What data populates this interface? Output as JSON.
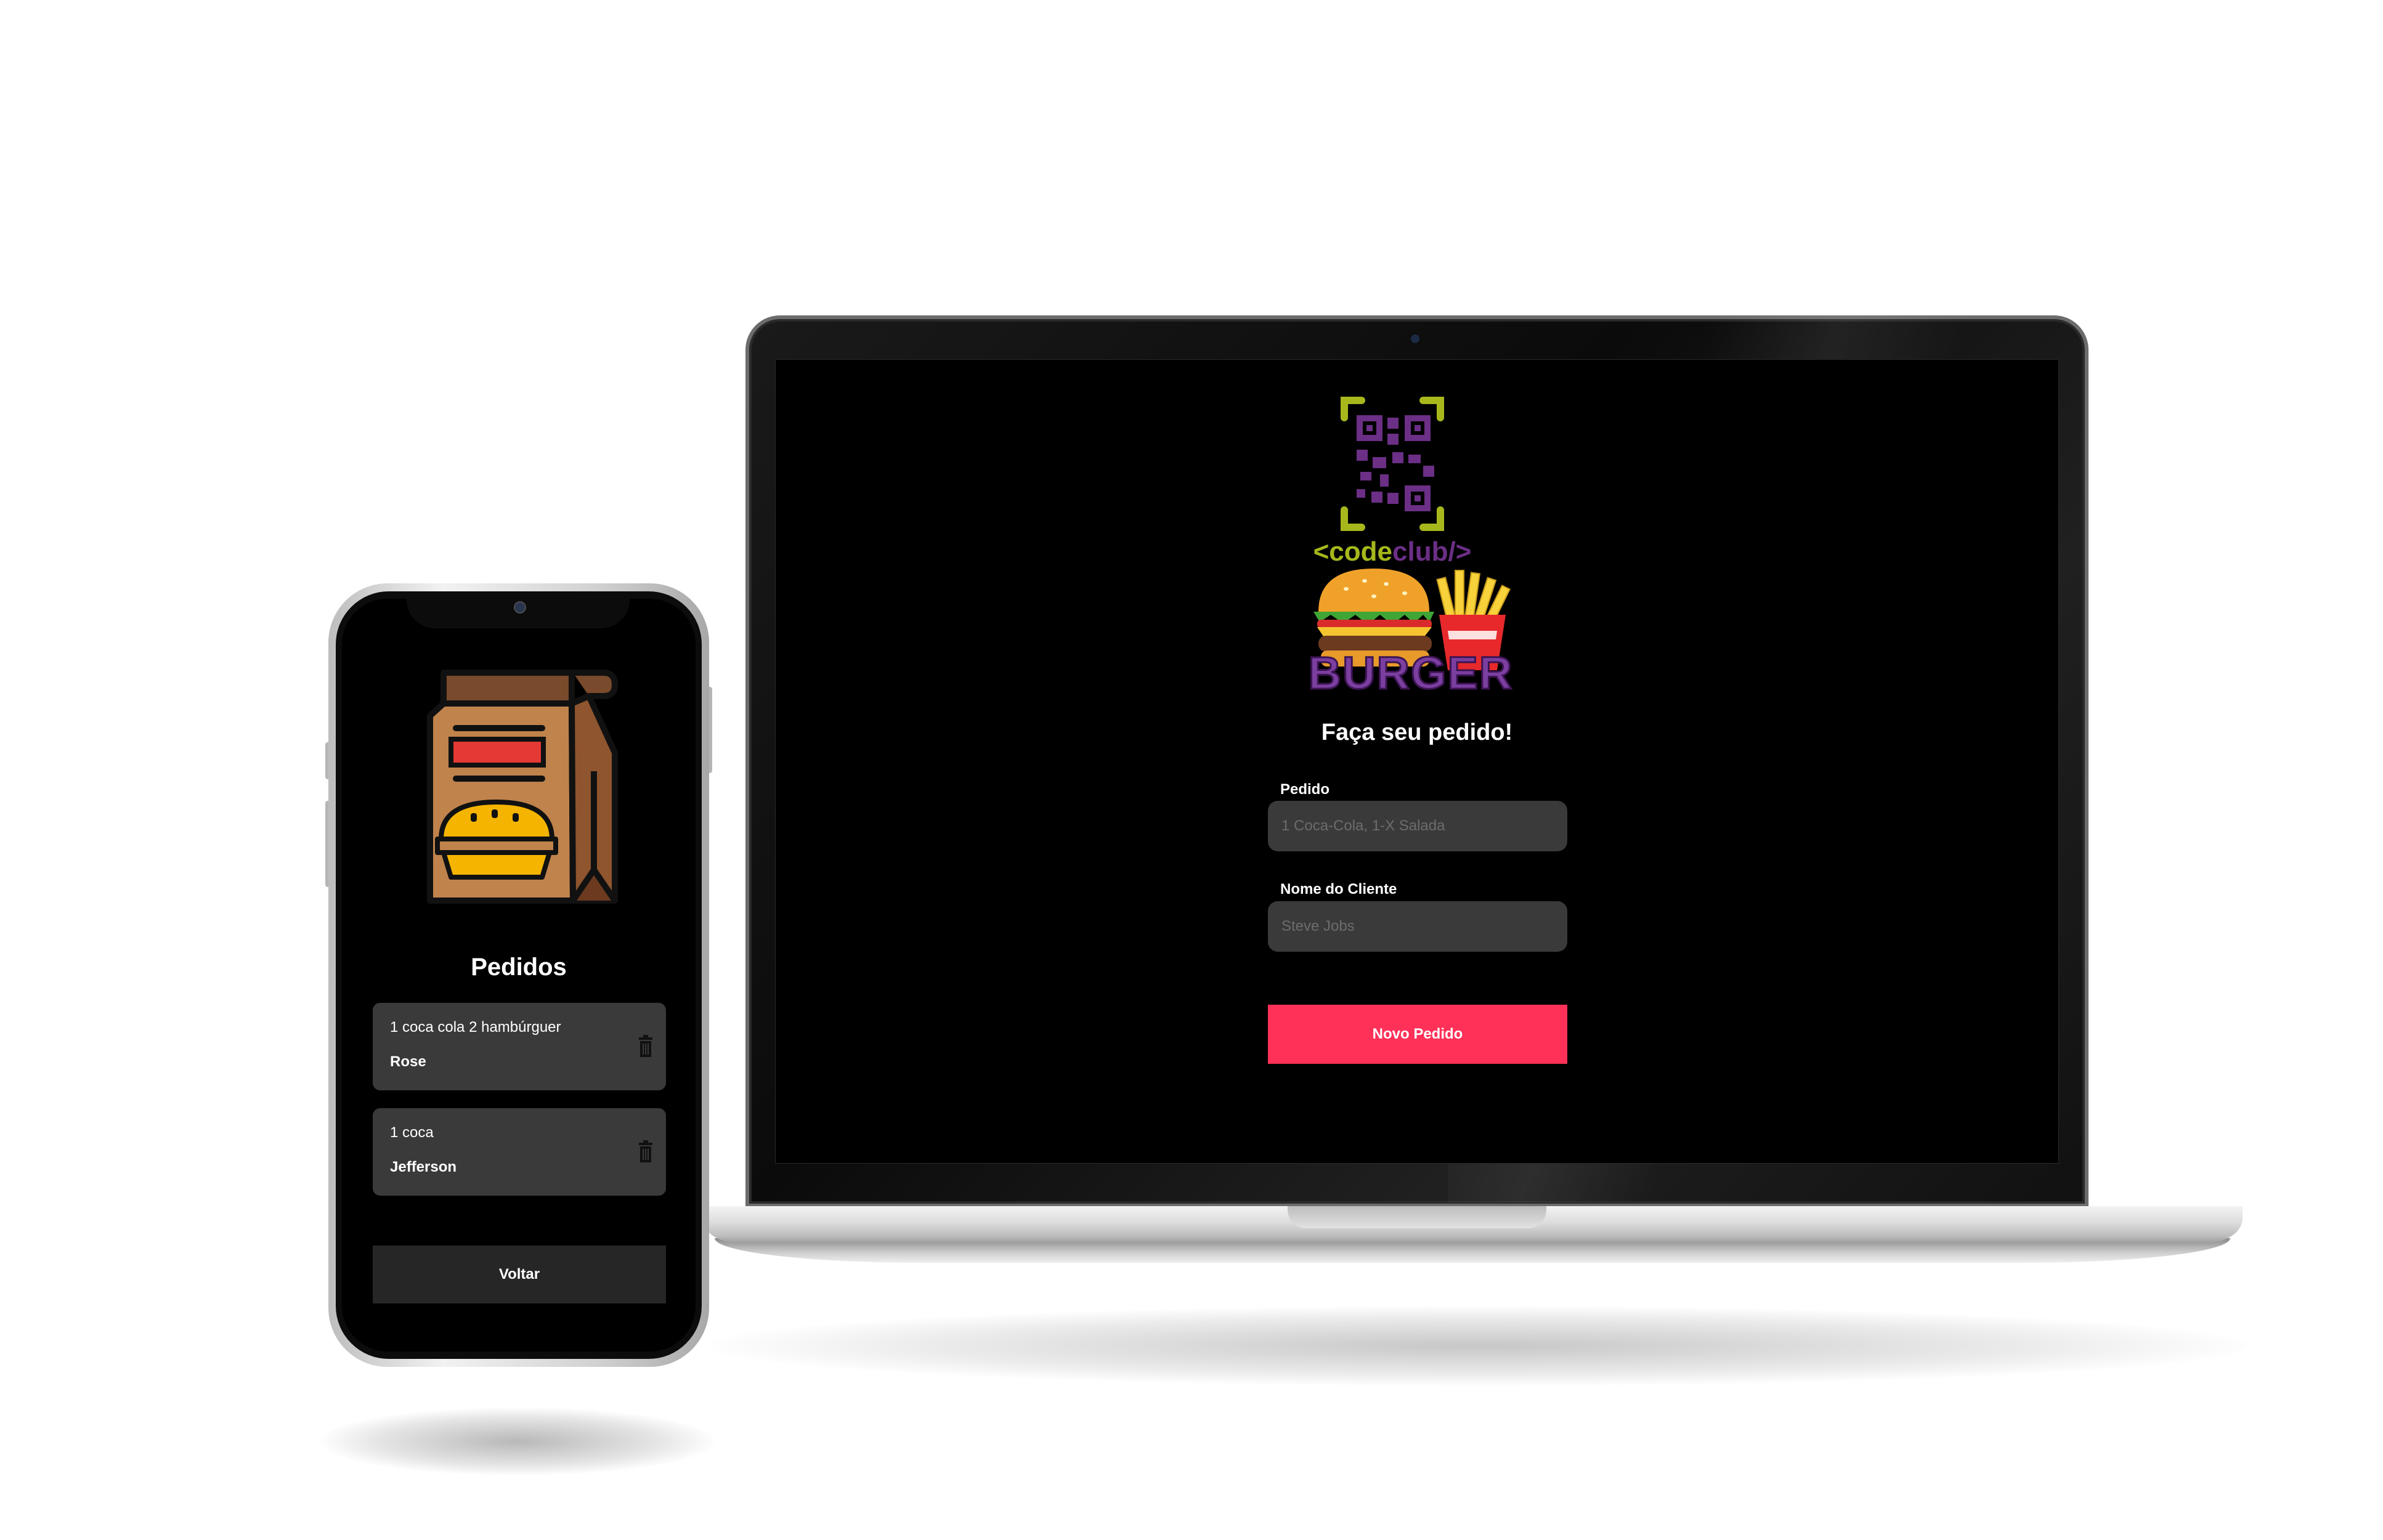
{
  "desktop": {
    "logo_text": "<codeclub/>",
    "logo_wordmark": "BURGER",
    "title": "Faça seu pedido!",
    "order_label": "Pedido",
    "order_placeholder": "1 Coca-Cola, 1-X Salada",
    "client_label": "Nome do Cliente",
    "client_placeholder": "Steve Jobs",
    "submit_label": "Novo Pedido"
  },
  "mobile": {
    "title": "Pedidos",
    "orders": [
      {
        "text": "1 coca cola 2 hambúrguer",
        "name": "Rose"
      },
      {
        "text": "1 coca",
        "name": "Jefferson"
      }
    ],
    "back_label": "Voltar"
  },
  "colors": {
    "accent": "#ff3158",
    "input_bg": "#3a3a3a",
    "screen_bg": "#000000",
    "logo_purple": "#6b2f86",
    "logo_green": "#a6b81c"
  }
}
